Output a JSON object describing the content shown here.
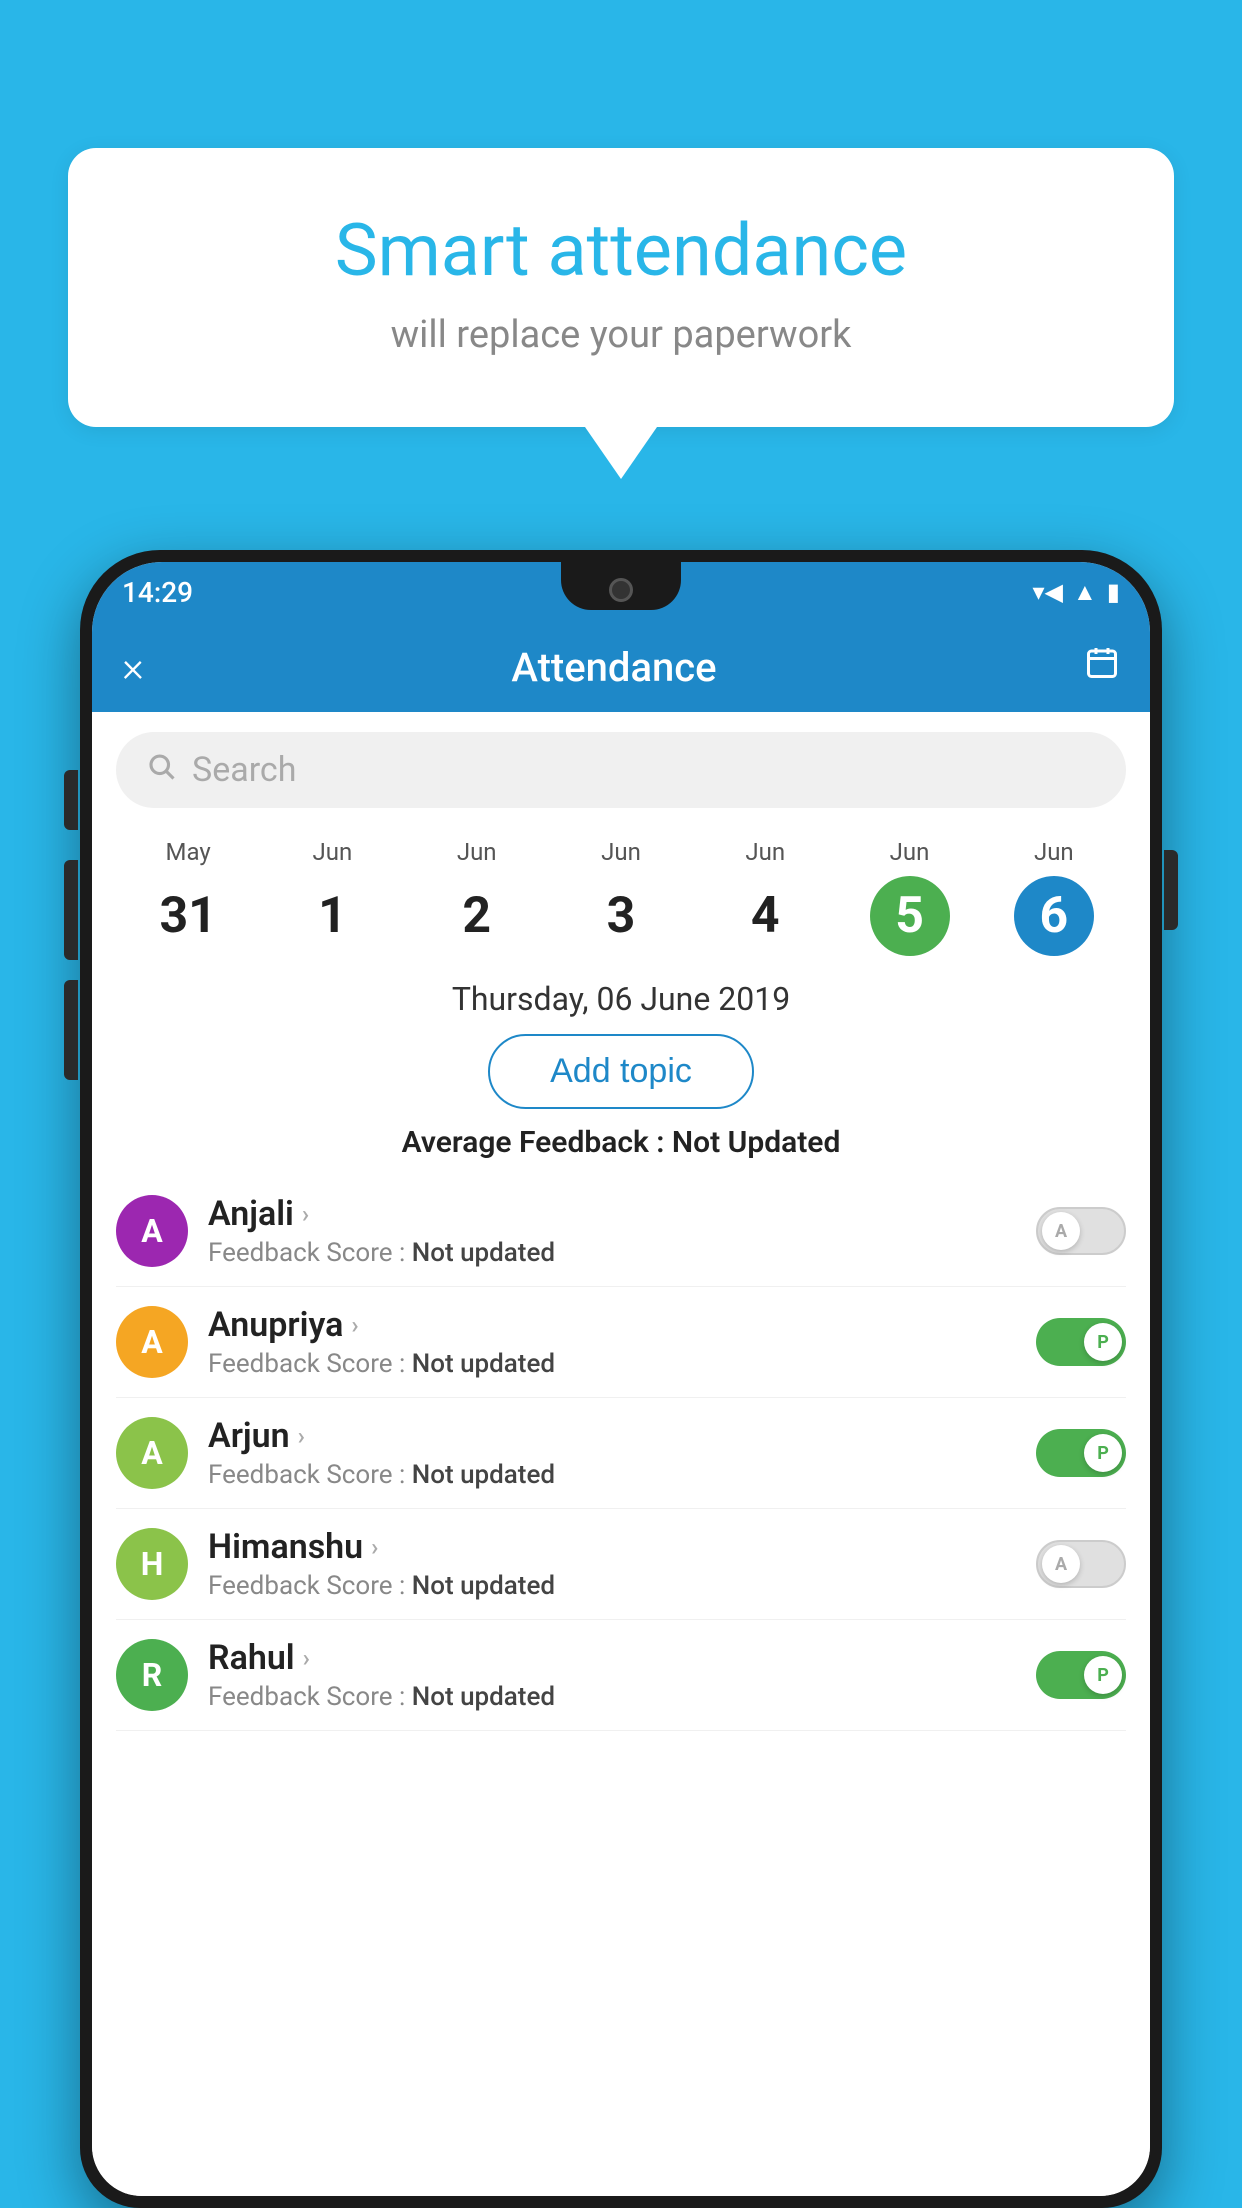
{
  "background_color": "#29b6e8",
  "speech_bubble": {
    "title": "Smart attendance",
    "subtitle": "will replace your paperwork"
  },
  "status_bar": {
    "time": "14:29",
    "icons": [
      "wifi",
      "signal",
      "battery"
    ]
  },
  "app_header": {
    "title": "Attendance",
    "close_label": "×",
    "calendar_icon": "📅"
  },
  "search": {
    "placeholder": "Search"
  },
  "calendar": {
    "days": [
      {
        "month": "May",
        "date": "31",
        "state": "normal"
      },
      {
        "month": "Jun",
        "date": "1",
        "state": "normal"
      },
      {
        "month": "Jun",
        "date": "2",
        "state": "normal"
      },
      {
        "month": "Jun",
        "date": "3",
        "state": "normal"
      },
      {
        "month": "Jun",
        "date": "4",
        "state": "normal"
      },
      {
        "month": "Jun",
        "date": "5",
        "state": "today"
      },
      {
        "month": "Jun",
        "date": "6",
        "state": "selected"
      }
    ]
  },
  "selected_date": "Thursday, 06 June 2019",
  "add_topic_label": "Add topic",
  "avg_feedback": {
    "label": "Average Feedback : ",
    "value": "Not Updated"
  },
  "students": [
    {
      "name": "Anjali",
      "initial": "A",
      "avatar_color": "#9c27b0",
      "feedback": "Feedback Score : ",
      "feedback_value": "Not updated",
      "toggle": "off",
      "toggle_label": "A"
    },
    {
      "name": "Anupriya",
      "initial": "A",
      "avatar_color": "#f5a623",
      "feedback": "Feedback Score : ",
      "feedback_value": "Not updated",
      "toggle": "on",
      "toggle_label": "P"
    },
    {
      "name": "Arjun",
      "initial": "A",
      "avatar_color": "#8bc34a",
      "feedback": "Feedback Score : ",
      "feedback_value": "Not updated",
      "toggle": "on",
      "toggle_label": "P"
    },
    {
      "name": "Himanshu",
      "initial": "H",
      "avatar_color": "#8bc34a",
      "feedback": "Feedback Score : ",
      "feedback_value": "Not updated",
      "toggle": "off",
      "toggle_label": "A"
    },
    {
      "name": "Rahul",
      "initial": "R",
      "avatar_color": "#4caf50",
      "feedback": "Feedback Score : ",
      "feedback_value": "Not updated",
      "toggle": "on",
      "toggle_label": "P"
    }
  ]
}
